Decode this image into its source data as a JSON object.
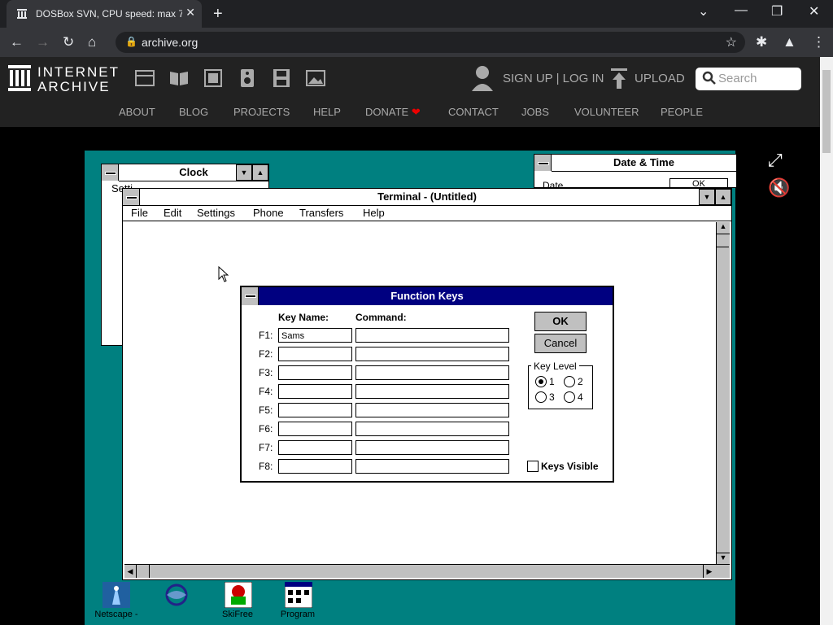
{
  "browser": {
    "tab_title": "DOSBox SVN, CPU speed: max 7",
    "address": "archive.org"
  },
  "ia": {
    "brand_line1": "INTERNET",
    "brand_line2": "ARCHIVE",
    "signup": "SIGN UP | LOG IN",
    "upload": "UPLOAD",
    "search_placeholder": "Search",
    "menu": [
      "ABOUT",
      "BLOG",
      "PROJECTS",
      "HELP",
      "DONATE",
      "CONTACT",
      "JOBS",
      "VOLUNTEER",
      "PEOPLE"
    ]
  },
  "windows": {
    "clock_title": "Clock",
    "clock_menu_partial": "Setti",
    "datetime_title": "Date & Time",
    "datetime_partial": "Date",
    "datetime_ok_partial": "OK",
    "terminal_title": "Terminal - (Untitled)",
    "terminal_menu": [
      "File",
      "Edit",
      "Settings",
      "Phone",
      "Transfers",
      "Help"
    ]
  },
  "dialog": {
    "title": "Function Keys",
    "key_name_header": "Key Name:",
    "command_header": "Command:",
    "keys": [
      {
        "label": "F1:",
        "name": "Sams",
        "command": ""
      },
      {
        "label": "F2:",
        "name": "",
        "command": ""
      },
      {
        "label": "F3:",
        "name": "",
        "command": ""
      },
      {
        "label": "F4:",
        "name": "",
        "command": ""
      },
      {
        "label": "F5:",
        "name": "",
        "command": ""
      },
      {
        "label": "F6:",
        "name": "",
        "command": ""
      },
      {
        "label": "F7:",
        "name": "",
        "command": ""
      },
      {
        "label": "F8:",
        "name": "",
        "command": ""
      }
    ],
    "ok": "OK",
    "cancel": "Cancel",
    "key_level_label": "Key Level",
    "levels": [
      "1",
      "2",
      "3",
      "4"
    ],
    "selected_level": "1",
    "keys_visible": "Keys Visible",
    "keys_visible_checked": false
  },
  "desktop_icons": [
    "Netscape -",
    "SkiFree",
    "Program"
  ]
}
